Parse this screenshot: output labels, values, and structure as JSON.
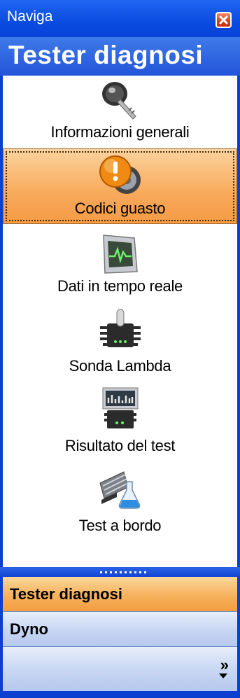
{
  "window": {
    "title": "Naviga",
    "close_icon": "close-icon"
  },
  "header": {
    "title": "Tester diagnosi"
  },
  "items": [
    {
      "label": "Informazioni generali",
      "icon": "key-icon",
      "selected": false
    },
    {
      "label": "Codici guasto",
      "icon": "warning-gauge-icon",
      "selected": true
    },
    {
      "label": "Dati in tempo reale",
      "icon": "monitor-icon",
      "selected": false
    },
    {
      "label": "Sonda Lambda",
      "icon": "sensor-icon",
      "selected": false
    },
    {
      "label": "Risultato del test",
      "icon": "test-results-icon",
      "selected": false
    },
    {
      "label": "Test a bordo",
      "icon": "onboard-test-icon",
      "selected": false
    }
  ],
  "nav": [
    {
      "label": "Tester diagnosi",
      "active": true
    },
    {
      "label": "Dyno",
      "active": false
    }
  ],
  "overflow": {
    "chevron": "»",
    "icon": "chevron-expand-icon"
  },
  "colors": {
    "accent_orange": "#f6b15c",
    "title_blue": "#0b4be0"
  }
}
